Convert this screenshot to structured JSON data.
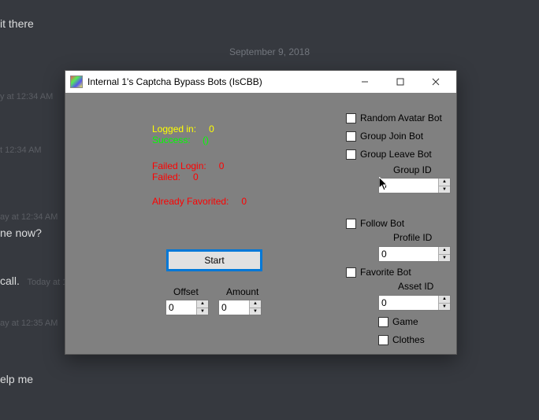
{
  "chat": {
    "line1": "it there",
    "date": "September 9, 2018",
    "ts1": "y at 12:34 AM",
    "ts2": "t 12:34 AM",
    "ts3": "ay at 12:34 AM",
    "line3": "ne now?",
    "line4a": "call.",
    "line4b": "Today at 1",
    "ts4": "ay at 12:35 AM",
    "line5": "elp me"
  },
  "window": {
    "title": "Internal 1's Captcha Bypass Bots (IsCBB)"
  },
  "stats": {
    "logged_in_label": "Logged in:",
    "logged_in_val": "0",
    "success_label": "Success:",
    "success_val": "()",
    "failed_login_label": "Failed Login:",
    "failed_login_val": "0",
    "failed_label": "Failed:",
    "failed_val": "0",
    "already_fav_label": "Already Favorited:",
    "already_fav_val": "0"
  },
  "controls": {
    "start": "Start",
    "offset_label": "Offset",
    "offset_val": "0",
    "amount_label": "Amount",
    "amount_val": "0"
  },
  "options": {
    "random_avatar": "Random Avatar Bot",
    "group_join": "Group Join Bot",
    "group_leave": "Group Leave Bot",
    "group_id_label": "Group ID",
    "group_id_val": "0",
    "follow": "Follow Bot",
    "profile_id_label": "Profile ID",
    "profile_id_val": "0",
    "favorite": "Favorite Bot",
    "asset_id_label": "Asset ID",
    "asset_id_val": "0",
    "game": "Game",
    "clothes": "Clothes"
  }
}
